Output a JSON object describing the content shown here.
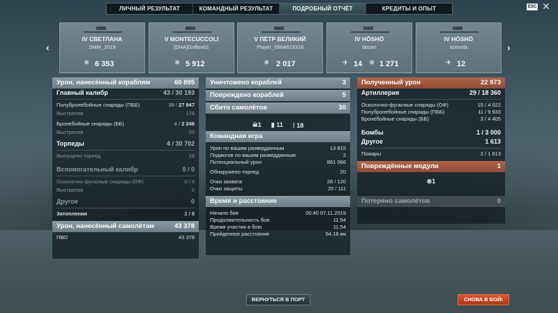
{
  "tabs": [
    "ЛИЧНЫЙ РЕЗУЛЬТАТ",
    "КОМАНДНЫЙ РЕЗУЛЬТАТ",
    "ПОДРОБНЫЙ ОТЧЁТ",
    "КРЕДИТЫ И ОПЫТ"
  ],
  "esc": "ESC",
  "ships": [
    {
      "name": "IV СВЕТЛАНА",
      "player": "SMM_2019",
      "stat1": "6 353",
      "stat2": ""
    },
    {
      "name": "V MONTECUCCOLI",
      "player": "[DHA]Griffon01",
      "stat1": "5 912",
      "stat2": ""
    },
    {
      "name": "V ПЁТР ВЕЛИКИЙ",
      "player": "Player_6564823318",
      "stat1": "2 017",
      "stat2": ""
    },
    {
      "name": "IV HŌSHŌ",
      "player": "tasser",
      "stat1": "14",
      "stat2": "1 271"
    },
    {
      "name": "IV HŌSHŌ",
      "player": "scevola",
      "stat1": "12",
      "stat2": ""
    }
  ],
  "left": {
    "total_label": "Урон, нанесённый кораблям",
    "total_value": "60 895",
    "main_label": "Главный калибр",
    "main_value": "43 / 30 193",
    "ap_label": "Полубронебойные снаряды (ПББ)",
    "ap_a": "39 / ",
    "ap_b": "27 947",
    "shots_label": "Выстрелов",
    "shots1": "176",
    "bb_label": "Бронебойные снаряды (ББ)",
    "bb_a": "4 / ",
    "bb_b": "2 246",
    "shots2": "20",
    "torp_label": "Торпеды",
    "torp_value": "4 / 30 702",
    "torp_fired_label": "Выпущено торпед",
    "torp_fired": "16",
    "sec_label": "Вспомогательный калибр",
    "sec_value": "0 / 0",
    "he_label": "Осколочно-фугасные снаряды (ОФ)",
    "he_value": "0 / 0",
    "shots3": "0",
    "other_label": "Другое",
    "other_value": "0",
    "flood_label": "Затопления",
    "flood_a": "2 / ",
    "flood_b": "0",
    "air_label": "Урон, нанесённый самолётам",
    "air_value": "43 378",
    "aa_label": "ПВО",
    "aa_value": "43 378"
  },
  "mid": {
    "destroyed_label": "Уничтожено кораблей",
    "destroyed": "3",
    "damaged_label": "Повреждено кораблей",
    "damaged": "5",
    "planes_label": "Сбито самолётов",
    "planes": "30",
    "icon1": "1",
    "icon2": "11",
    "icon3": "18",
    "team_label": "Командная игра",
    "spot_dmg_label": "Урон по вашим разведданным",
    "spot_dmg": "13 815",
    "fires_spot_label": "Поджогов по вашим разведданным",
    "fires_spot": "2",
    "potential_label": "Потенциальный урон",
    "potential": "861 066",
    "torp_spot_label": "Обнаружено торпед",
    "torp_spot": "20",
    "cap_label": "Очки захвата",
    "cap": "28 / 120",
    "def_label": "Очки защиты",
    "def": "20 / 111",
    "time_label": "Время и расстояние",
    "start_label": "Начало боя",
    "start": "00:40  07.11.2019",
    "dur_label": "Продолжительность боя",
    "dur": "11:54",
    "part_label": "Время участия в бою",
    "part": "11:54",
    "dist_label": "Пройденное расстояние",
    "dist": "54.18 км"
  },
  "right": {
    "recv_label": "Полученный урон",
    "recv": "22 973",
    "art_label": "Артиллерия",
    "art": "29 / 18 360",
    "he_label": "Осколочно-фугасные снаряды (ОФ)",
    "he": "15 / 4 022",
    "ap_label": "Полубронебойные снаряды (ПББ)",
    "ap": "11 / 9 933",
    "bb_label": "Бронебойные снаряды (ББ)",
    "bb": "3 / 4 405",
    "bombs_label": "Бомбы",
    "bombs": "1 / 3 000",
    "other_label": "Другое",
    "other": "1 613",
    "fires_label": "Пожары",
    "fires": "2 / 1 613",
    "modules_label": "Повреждённые модули",
    "modules": "1",
    "module_count": "1",
    "lost_label": "Потеряно самолётов",
    "lost": "0"
  },
  "buttons": {
    "port": "ВЕРНУТЬСЯ В ПОРТ",
    "battle": "СНОВА В БОЙ!"
  }
}
